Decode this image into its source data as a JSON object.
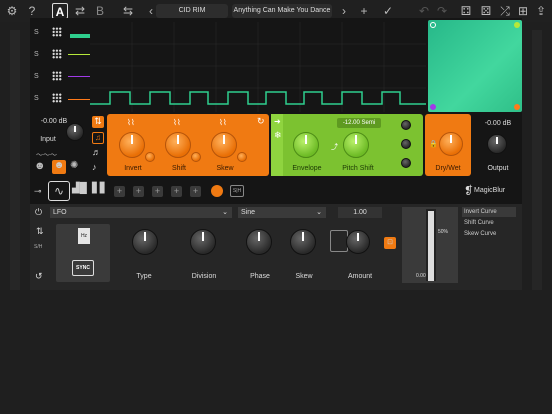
{
  "toolbar": {
    "left_icons": [
      "settings-icon",
      "help-icon",
      "ab-a-icon",
      "ab-swap-icon",
      "ab-b-icon",
      "insert-icon"
    ],
    "help": "?",
    "a": "A",
    "b": "B",
    "prev": "‹",
    "next": "›",
    "preset_name": "CID RIM",
    "preset_subtitle": "Anything Can Make You Dance",
    "right_icons": [
      "add-icon",
      "check-icon",
      "undo-icon",
      "redo-icon",
      "dice-icon",
      "dice2-icon",
      "shuffle-icon",
      "network-icon"
    ]
  },
  "sequencer": {
    "rows": [
      {
        "label": "S",
        "color": "#3ad1a4"
      },
      {
        "label": "S",
        "color": "#b6e83a"
      },
      {
        "label": "S",
        "color": "#a03ae8"
      },
      {
        "label": "S",
        "color": "#ff7a1a"
      }
    ]
  },
  "input": {
    "value": "-0.00 dB",
    "label": "Input"
  },
  "orange_block": {
    "knobs": [
      {
        "label": "Invert"
      },
      {
        "label": "Shift"
      },
      {
        "label": "Skew"
      }
    ]
  },
  "green_block": {
    "pitch": "-12.00 Semi",
    "knobs": [
      {
        "label": "Envelope"
      },
      {
        "label": "Pitch Shift"
      }
    ]
  },
  "drywet": {
    "label": "Dry/Wet"
  },
  "output": {
    "value": "-0.00 dB",
    "label": "Output"
  },
  "brand": {
    "name": "MagicBlur"
  },
  "lfo": {
    "source": "LFO",
    "wave": "Sine",
    "amount_value": "1.00",
    "labels": {
      "type": "Type",
      "division": "Division",
      "phase": "Phase",
      "skew": "Skew",
      "amount": "Amount",
      "sync": "SYNC",
      "hz": "Hz",
      "pct": "50%",
      "db": "0.00"
    },
    "curves": [
      "Invert Curve",
      "Shift Curve",
      "Skew Curve"
    ]
  },
  "colors": {
    "orange": "#f07a12",
    "green": "#7cc230",
    "teal": "#2fcf8e"
  }
}
